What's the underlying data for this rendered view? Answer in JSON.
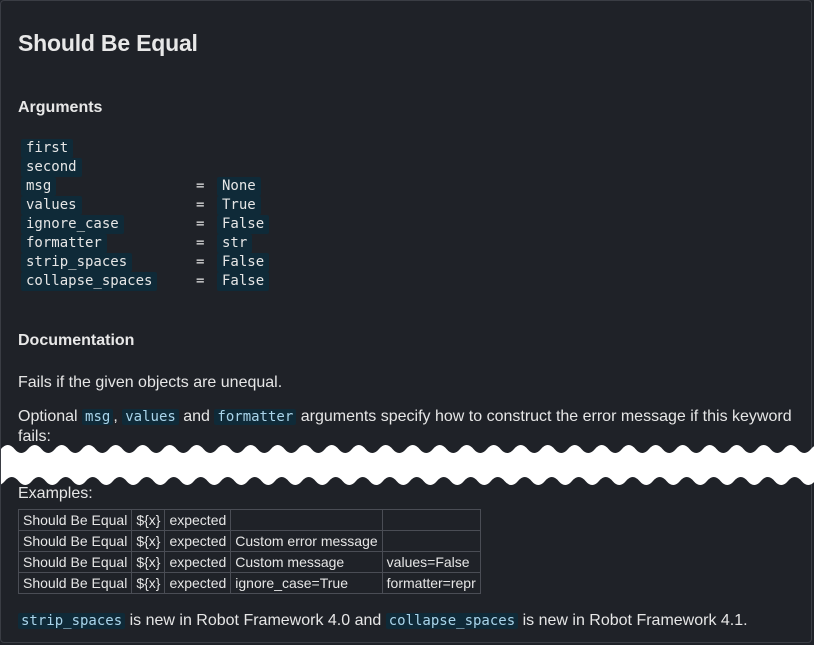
{
  "keyword": {
    "title": "Should Be Equal"
  },
  "arguments": {
    "heading": "Arguments",
    "items": [
      {
        "name": "first",
        "eq": "",
        "default": ""
      },
      {
        "name": "second",
        "eq": "",
        "default": ""
      },
      {
        "name": "msg",
        "eq": "=",
        "default": "None"
      },
      {
        "name": "values",
        "eq": "=",
        "default": "True"
      },
      {
        "name": "ignore_case",
        "eq": "=",
        "default": "False"
      },
      {
        "name": "formatter",
        "eq": "=",
        "default": "str"
      },
      {
        "name": "strip_spaces",
        "eq": "=",
        "default": "False"
      },
      {
        "name": "collapse_spaces",
        "eq": "=",
        "default": "False"
      }
    ]
  },
  "documentation": {
    "heading": "Documentation",
    "p1": "Fails if the given objects are unequal.",
    "p2": {
      "t1": "Optional ",
      "c1": "msg",
      "t2": ", ",
      "c2": "values",
      "t3": " and ",
      "c3": "formatter",
      "t4": " arguments specify how to construct the error message if this keyword fails:"
    },
    "examples_label": "Examples:",
    "examples": [
      [
        "Should Be Equal",
        "${x}",
        "expected",
        "",
        ""
      ],
      [
        "Should Be Equal",
        "${x}",
        "expected",
        "Custom error message",
        ""
      ],
      [
        "Should Be Equal",
        "${x}",
        "expected",
        "Custom message",
        "values=False"
      ],
      [
        "Should Be Equal",
        "${x}",
        "expected",
        "ignore_case=True",
        "formatter=repr"
      ]
    ],
    "footer": {
      "c1": "strip_spaces",
      "t1": " is new in Robot Framework 4.0 and ",
      "c2": "collapse_spaces",
      "t2": " is new in Robot Framework 4.1."
    }
  }
}
